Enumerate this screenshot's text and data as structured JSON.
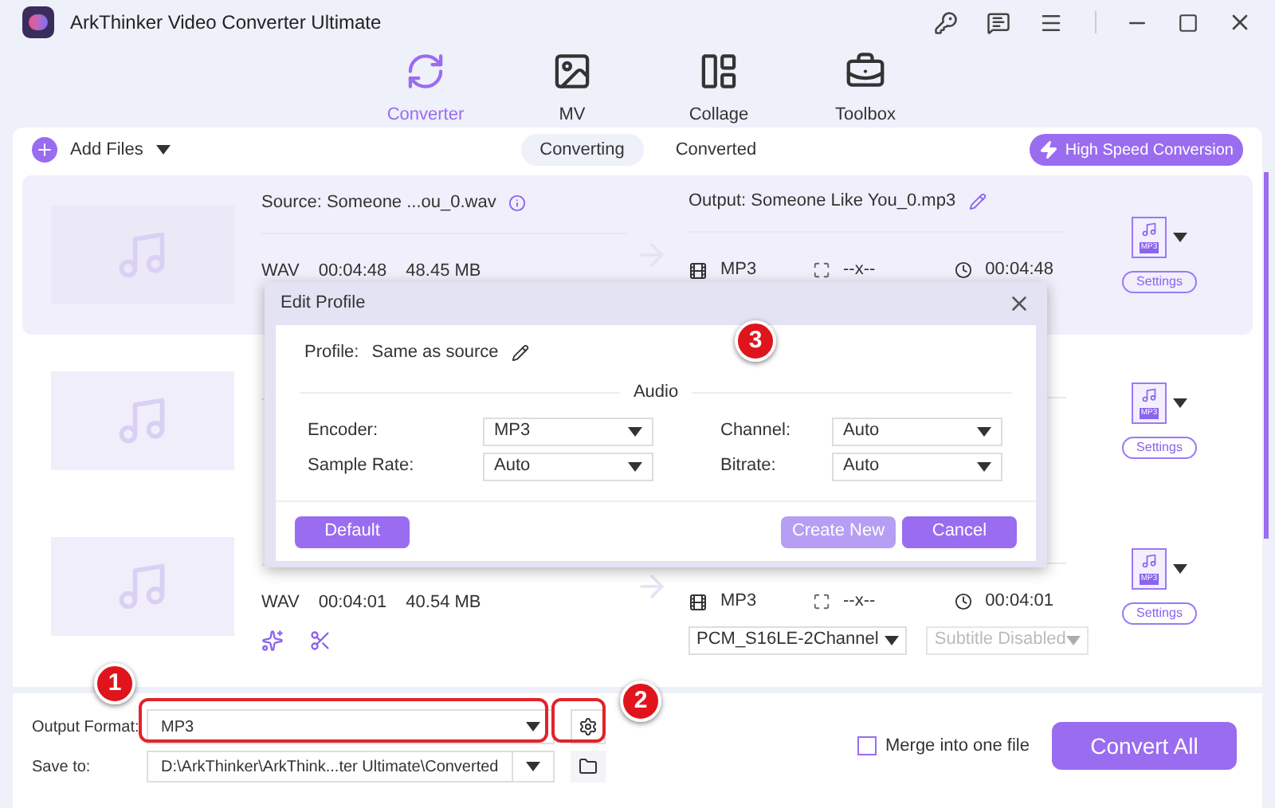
{
  "app": {
    "title": "ArkThinker Video Converter Ultimate"
  },
  "nav": [
    {
      "label": "Converter",
      "selected": true,
      "kind": "converter"
    },
    {
      "label": "MV",
      "selected": false,
      "kind": "mv"
    },
    {
      "label": "Collage",
      "selected": false,
      "kind": "collage"
    },
    {
      "label": "Toolbox",
      "selected": false,
      "kind": "toolbox"
    }
  ],
  "toolbar": {
    "add_files": "Add Files",
    "tabs": [
      {
        "label": "Converting",
        "selected": true
      },
      {
        "label": "Converted",
        "selected": false
      }
    ],
    "high_speed": "High Speed Conversion"
  },
  "files": [
    {
      "selected": true,
      "source": "Source: Someone ...ou_0.wav",
      "format": "WAV",
      "duration": "00:04:48",
      "size": "48.45 MB",
      "output": "Output: Someone Like You_0.mp3",
      "out_format": "MP3",
      "resolution": "--x--",
      "out_duration": "00:04:48",
      "format_badge": "MP3",
      "settings": "Settings",
      "edit_tools": false
    },
    {
      "selected": false,
      "format_badge": "MP3",
      "settings": "Settings",
      "edit_tools": false
    },
    {
      "selected": false,
      "format": "WAV",
      "duration": "00:04:01",
      "size": "40.54 MB",
      "out_format": "MP3",
      "resolution": "--x--",
      "out_duration": "00:04:01",
      "audio_track": "PCM_S16LE-2Channel",
      "subtitle": {
        "value": "Subtitle Disabled",
        "disabled": true
      },
      "format_badge": "MP3",
      "settings": "Settings",
      "edit_tools": true
    }
  ],
  "bottom": {
    "output_format_label": "Output Format:",
    "output_format": "MP3",
    "save_to_label": "Save to:",
    "save_to": "D:\\ArkThinker\\ArkThink...ter Ultimate\\Converted",
    "merge": {
      "label": "Merge into one file",
      "checked": false
    },
    "convert_all": "Convert All"
  },
  "dialog": {
    "title": "Edit Profile",
    "profile_label": "Profile:",
    "profile": "Same as source",
    "section": "Audio",
    "fields": [
      {
        "label": "Encoder:",
        "value": "MP3"
      },
      {
        "label": "Channel:",
        "value": "Auto"
      },
      {
        "label": "Sample Rate:",
        "value": "Auto"
      },
      {
        "label": "Bitrate:",
        "value": "Auto"
      }
    ],
    "buttons": [
      {
        "label": "Default",
        "disabled": false
      },
      {
        "label": "Create New",
        "disabled": true
      },
      {
        "label": "Cancel",
        "disabled": false
      }
    ]
  },
  "annotations": [
    "1",
    "2",
    "3"
  ]
}
